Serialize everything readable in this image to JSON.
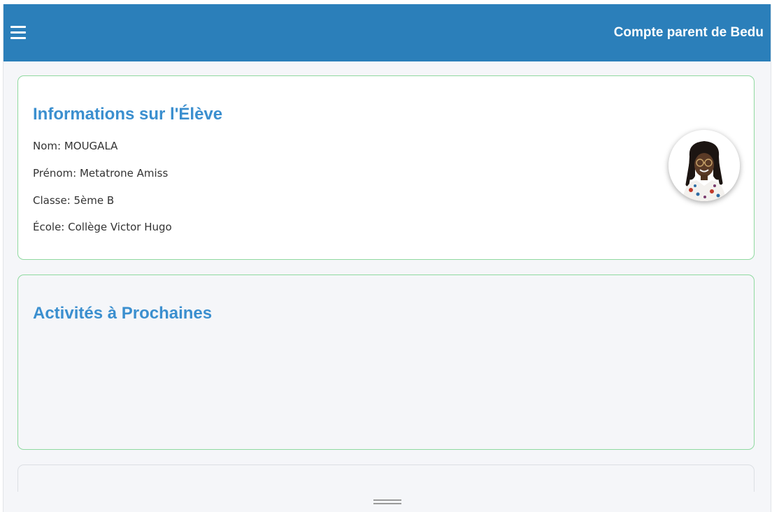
{
  "header": {
    "title": "Compte parent de Bedu",
    "menu_icon": "hamburger-menu-icon",
    "background_color": "#2b7fba"
  },
  "student_info": {
    "title": "Informations sur l'Élève",
    "nom": "Nom: MOUGALA",
    "prenom": "Prénom: Metatrone Amiss",
    "classe": "Classe: 5ème B",
    "ecole": "École: Collège Victor Hugo",
    "photo": "student-photo"
  },
  "activities": {
    "title": "Activités à Prochaines"
  },
  "colors": {
    "accent_title": "#3b8fcf",
    "card_border": "#8fd9a0"
  }
}
